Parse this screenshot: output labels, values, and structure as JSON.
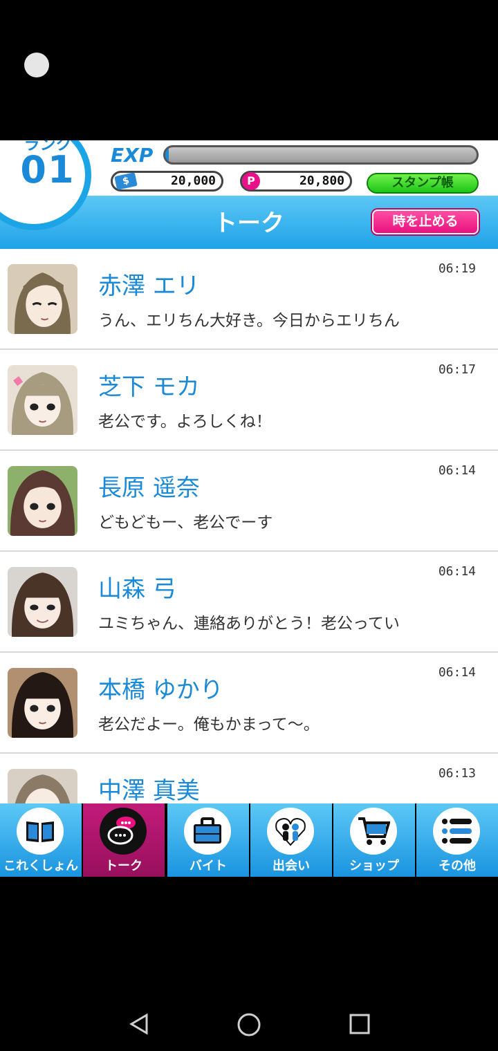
{
  "header": {
    "rank_label": "ランク",
    "rank_value": "01",
    "exp_label": "EXP",
    "exp_progress": 0.01,
    "money_value": "20,000",
    "points_value": "20,800",
    "money_icon": "$",
    "points_icon": "P",
    "stamp_button": "スタンプ帳",
    "title": "トーク",
    "stop_time_button": "時を止める"
  },
  "talks": [
    {
      "name": "赤澤 エリ",
      "message": "うん、エリちん大好き。今日からエリちん",
      "time": "06:19"
    },
    {
      "name": "芝下 モカ",
      "message": "老公です。よろしくね！",
      "time": "06:17"
    },
    {
      "name": "長原 遥奈",
      "message": "どもどもー、老公でーす",
      "time": "06:14"
    },
    {
      "name": "山森 弓",
      "message": "ユミちゃん、連絡ありがとう！老公ってい",
      "time": "06:14"
    },
    {
      "name": "本橋 ゆかり",
      "message": "老公だよー。俺もかまって〜。",
      "time": "06:14"
    },
    {
      "name": "中澤 真美",
      "message": "",
      "time": "06:13"
    }
  ],
  "nav": [
    {
      "label": "これくしょん",
      "icon": "book-icon"
    },
    {
      "label": "トーク",
      "icon": "chat-icon"
    },
    {
      "label": "バイト",
      "icon": "briefcase-icon"
    },
    {
      "label": "出会い",
      "icon": "couple-heart-icon"
    },
    {
      "label": "ショップ",
      "icon": "cart-icon"
    },
    {
      "label": "その他",
      "icon": "menu-list-icon"
    }
  ],
  "colors": {
    "accent_blue": "#1ba4e6",
    "active_tab": "#c21b7a",
    "stamp_green": "#1cc61a",
    "stop_pink": "#e8117e"
  }
}
